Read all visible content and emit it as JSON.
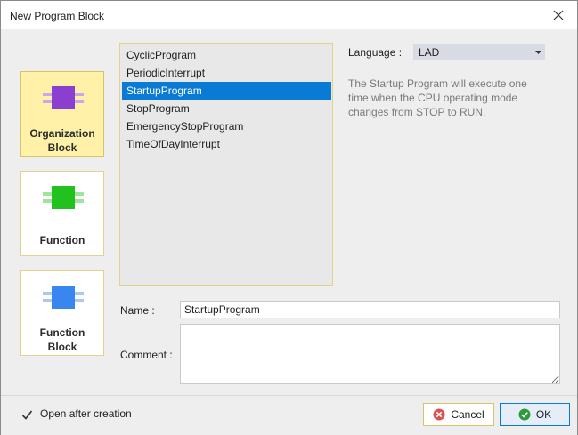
{
  "window": {
    "title": "New Program Block"
  },
  "block_types": [
    {
      "label_line1": "Organization",
      "label_line2": "Block",
      "icon": "purple-block-icon",
      "color": "#8a3fd1",
      "selected": true
    },
    {
      "label_line1": "Function",
      "label_line2": "",
      "icon": "green-block-icon",
      "color": "#22c21e",
      "selected": false
    },
    {
      "label_line1": "Function",
      "label_line2": "Block",
      "icon": "blue-block-icon",
      "color": "#3a86f0",
      "selected": false
    }
  ],
  "programs": [
    "CyclicProgram",
    "PeriodicInterrupt",
    "StartupProgram",
    "StopProgram",
    "EmergencyStopProgram",
    "TimeOfDayInterrupt"
  ],
  "selected_program": "StartupProgram",
  "language": {
    "label": "Language :",
    "value": "LAD"
  },
  "description": "The Startup Program will execute one time when the CPU operating mode changes from STOP to RUN.",
  "form": {
    "name_label": "Name :",
    "name_value": "StartupProgram",
    "comment_label": "Comment :",
    "comment_value": ""
  },
  "footer": {
    "open_after_label": "Open after creation",
    "open_after_checked": true,
    "cancel_label": "Cancel",
    "ok_label": "OK"
  },
  "colors": {
    "accent": "#0a7bd4",
    "selected_tile": "#fff2a8",
    "cancel_icon": "#d9534f",
    "ok_icon": "#2e9b3a"
  }
}
